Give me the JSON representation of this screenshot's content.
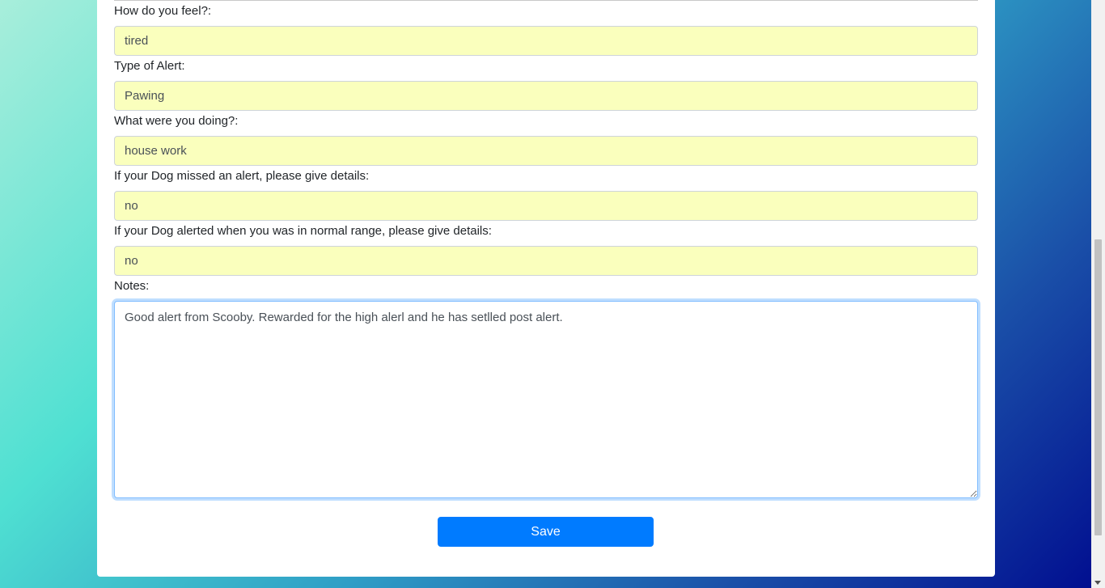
{
  "form": {
    "feel": {
      "label": "How do you feel?:",
      "value": "tired"
    },
    "alert_type": {
      "label": "Type of Alert:",
      "value": "Pawing"
    },
    "doing": {
      "label": "What were you doing?:",
      "value": "house work"
    },
    "missed_alert": {
      "label": "If your Dog missed an alert, please give details:",
      "value": "no"
    },
    "normal_range_alert": {
      "label": "If your Dog alerted when you was in normal range, please give details:",
      "value": "no"
    },
    "notes": {
      "label": "Notes:",
      "value": "Good alert from Scooby. Rewarded for the high alerl and he has setlled post alert."
    },
    "save_label": "Save"
  },
  "colors": {
    "autofill_bg": "#faffbd",
    "primary": "#007bff",
    "focus_border": "#80bdff"
  }
}
